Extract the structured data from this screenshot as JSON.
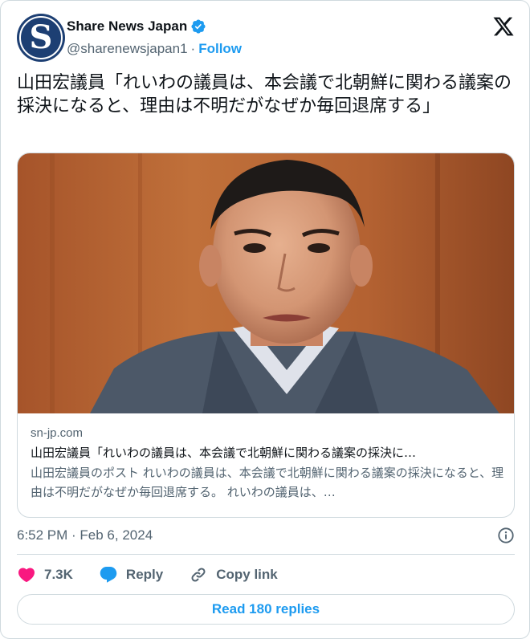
{
  "author": {
    "display_name": "Share News Japan",
    "handle": "@sharenewsjapan1",
    "separator": "·",
    "follow_label": "Follow",
    "avatar_letter": "S",
    "verified": true
  },
  "tweet": {
    "text": "山田宏議員「れいわの議員は、本会議で北朝鮮に関わる議案の採決になると、理由は不明だがなぜか毎回退席する」"
  },
  "link_card": {
    "domain": "sn-jp.com",
    "title": "山田宏議員「れいわの議員は、本会議で北朝鮮に関わる議案の採決に…",
    "description": "山田宏議員のポスト れいわの議員は、本会議で北朝鮮に関わる議案の採決になると、理由は不明だがなぜか毎回退席する。 れいわの議員は、…",
    "image_icon": "person-photo"
  },
  "timestamp": "6:52 PM · Feb 6, 2024",
  "actions": {
    "like_count": "7.3K",
    "reply_label": "Reply",
    "copy_link_label": "Copy link"
  },
  "read_replies_label": "Read 180 replies",
  "colors": {
    "accent": "#1d9bf0",
    "like": "#f91880",
    "avatar_bg": "#1d3f73",
    "muted_text": "#536471",
    "border": "#cfd9de"
  },
  "icons": {
    "logo": "x-logo-icon",
    "verified": "verified-badge-icon",
    "info": "info-icon",
    "like": "heart-icon",
    "reply": "reply-bubble-icon",
    "copy_link": "link-icon"
  }
}
